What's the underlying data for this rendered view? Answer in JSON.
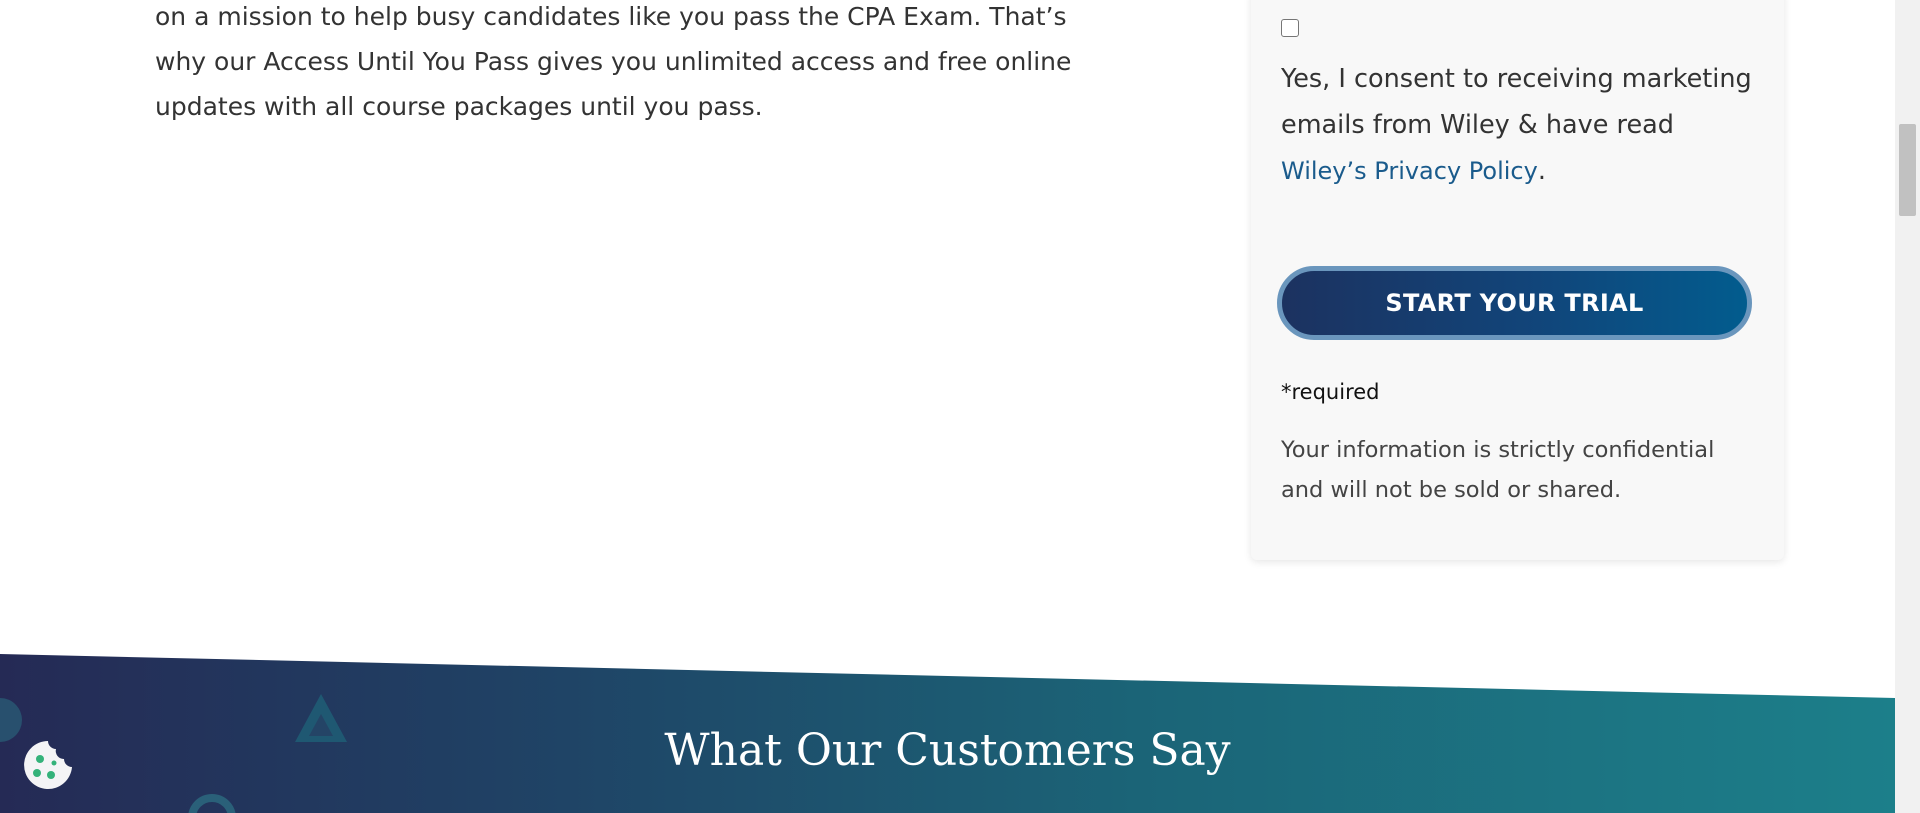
{
  "intro": {
    "lines": [
      "on a mission to help busy candidates like you pass the CPA Exam. That’s",
      "why our Access Until You Pass gives you unlimited access and free online",
      "updates with all course packages until you pass."
    ]
  },
  "form": {
    "consent_text": "Yes, I consent to receiving marketing emails from Wiley & have read ",
    "privacy_link": "Wiley’s Privacy Policy",
    "consent_end": ".",
    "submit_label": "START YOUR TRIAL",
    "required_note": "*required",
    "confidential_note": "Your information is strictly confidential and will not be sold or shared."
  },
  "testimonials": {
    "title": "What Our Customers Say"
  },
  "colors": {
    "button_start": "#1c3260",
    "button_end": "#025c8e",
    "link": "#1a5b8c",
    "band_start": "#252a55",
    "band_end": "#1c7f8a"
  },
  "icons": {
    "cookie": "cookie-icon",
    "checkbox": "checkbox"
  }
}
